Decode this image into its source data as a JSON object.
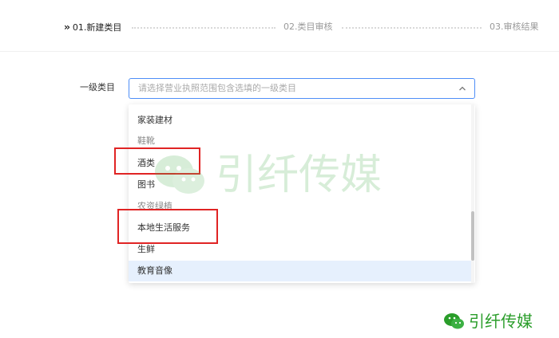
{
  "steps": [
    {
      "label": "01.新建类目",
      "state": "active"
    },
    {
      "label": "02.类目审核",
      "state": "inactive"
    },
    {
      "label": "03.审核结果",
      "state": "inactive"
    }
  ],
  "form": {
    "label": "一级类目",
    "select": {
      "placeholder": "请选择营业执照范围包含选填的一级类目",
      "expanded": true
    }
  },
  "dropdown": {
    "options": [
      {
        "label": "家装建材"
      },
      {
        "label": "鞋靴"
      },
      {
        "label": "酒类",
        "highlighted": true
      },
      {
        "label": "图书"
      },
      {
        "label": "农资绿植"
      },
      {
        "label": "本地生活服务",
        "highlighted": true
      },
      {
        "label": "生鲜"
      },
      {
        "label": "教育音像",
        "hovered": true
      }
    ]
  },
  "watermark": {
    "text": "引纤传媒",
    "small_text": "引纤传媒",
    "icon": "wechat-icon"
  },
  "colors": {
    "accent": "#4e8ef7",
    "highlight_box": "#e02424",
    "hover_bg": "#e6f0fd",
    "watermark": "#4caf50"
  }
}
